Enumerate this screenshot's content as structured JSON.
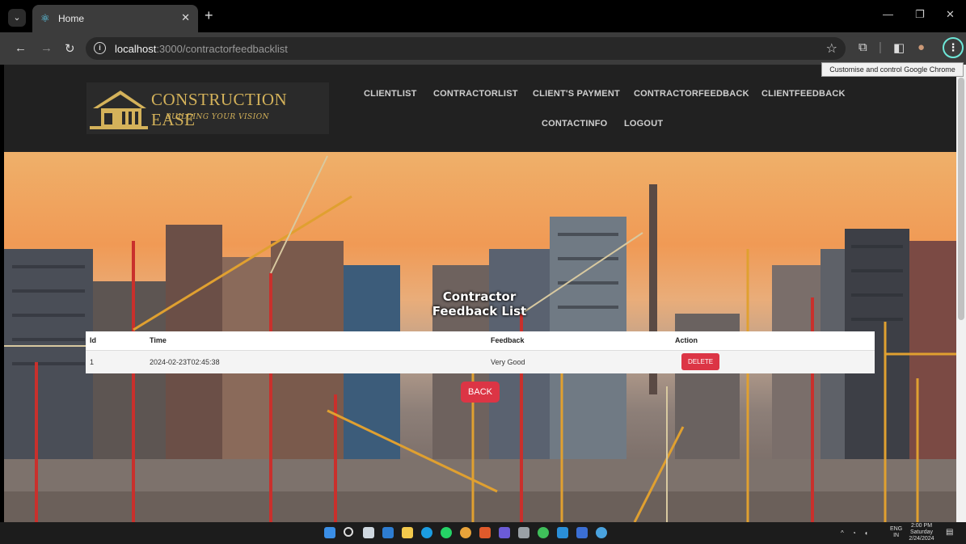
{
  "browser": {
    "tab_title": "Home",
    "url_host": "localhost",
    "url_path": ":3000/contractorfeedbacklist",
    "tooltip": "Customise and control Google Chrome"
  },
  "site": {
    "logo_name": "CONSTRUCTION EASE",
    "logo_tagline": "BUILDING YOUR VISION",
    "nav": [
      "CLIENTLIST",
      "CONTRACTORLIST",
      "CLIENT'S PAYMENT",
      "CONTRACTORFEEDBACK",
      "CLIENTFEEDBACK",
      "CONTACTINFO",
      "LOGOUT"
    ]
  },
  "main": {
    "title": "Contractor Feedback List",
    "table": {
      "headers": [
        "Id",
        "Time",
        "Feedback",
        "Action"
      ],
      "rows": [
        {
          "id": "1",
          "time": "2024-02-23T02:45:38",
          "feedback": "Very Good",
          "action": "DELETE"
        }
      ]
    },
    "back_label": "BACK"
  },
  "taskbar": {
    "lang": "ENG",
    "region": "IN",
    "time": "2:00 PM",
    "day": "Saturday",
    "date": "2/24/2024"
  },
  "colors": {
    "accent_red": "#dc3545",
    "header_bg": "#212121",
    "logo_gold": "#d4b25a"
  }
}
